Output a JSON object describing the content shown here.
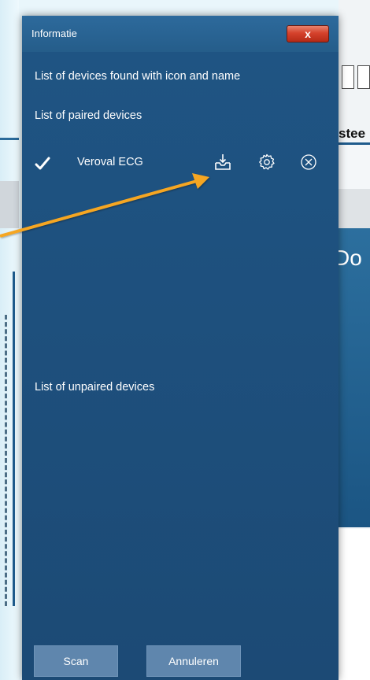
{
  "background": {
    "ribbon_text": "stee",
    "hero_text": "Do"
  },
  "dialog": {
    "title": "Informatie",
    "close_label": "x",
    "header_text": "List of devices found with icon and name",
    "paired_heading": "List of paired devices",
    "paired_devices": [
      {
        "name": "Veroval ECG",
        "status": "paired",
        "icons": [
          "download-icon",
          "gear-icon",
          "remove-icon"
        ]
      }
    ],
    "unpaired_heading": "List of unpaired devices",
    "buttons": {
      "scan": "Scan",
      "cancel": "Annuleren"
    }
  },
  "colors": {
    "dialog_bg": "#1d4f7a",
    "title_bg": "#2d6a9c",
    "close_red": "#d5422c",
    "button_bg": "#5f86ad",
    "arrow": "#f5a623"
  }
}
